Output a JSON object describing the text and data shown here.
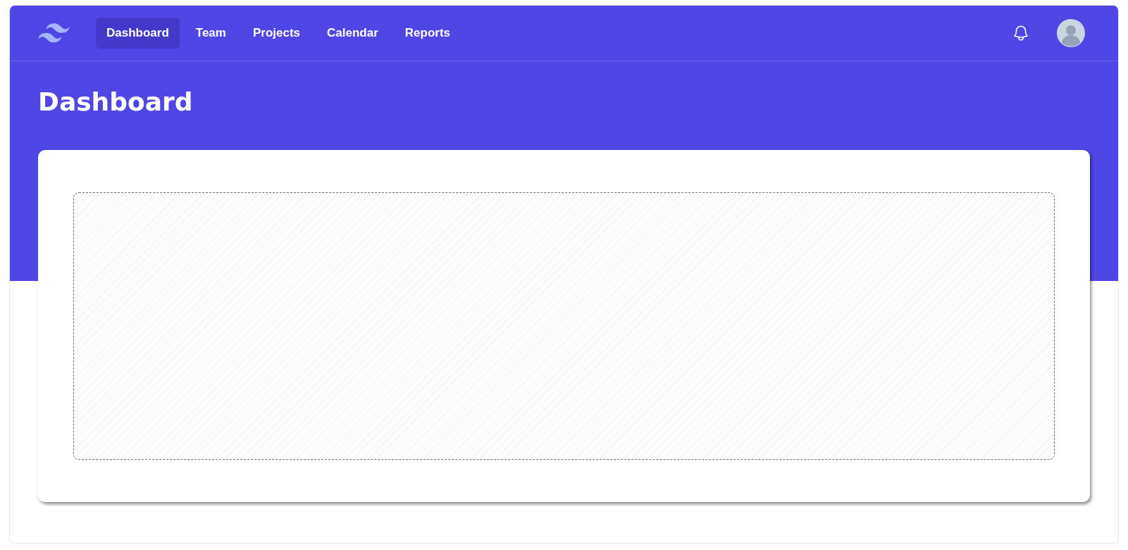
{
  "nav": {
    "items": [
      {
        "label": "Dashboard",
        "selected": true
      },
      {
        "label": "Team",
        "selected": false
      },
      {
        "label": "Projects",
        "selected": false
      },
      {
        "label": "Calendar",
        "selected": false
      },
      {
        "label": "Reports",
        "selected": false
      }
    ]
  },
  "header": {
    "title": "Dashboard"
  }
}
